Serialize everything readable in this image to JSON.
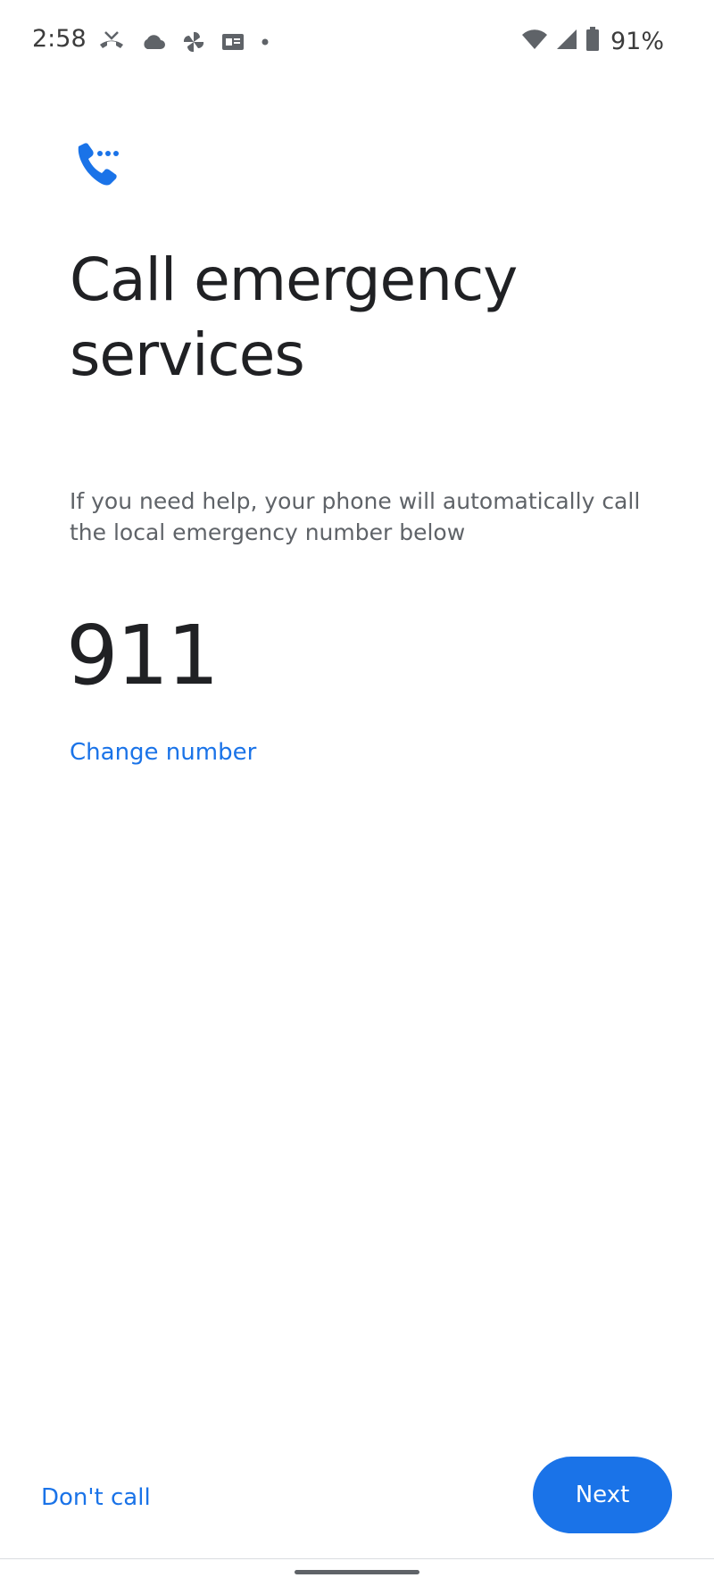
{
  "status_bar": {
    "time": "2:58",
    "battery_percent": "91%",
    "left_icons": [
      "missed-call-icon",
      "cloud-icon",
      "pinwheel-app-icon",
      "news-app-icon",
      "notification-dot-icon"
    ],
    "right_icons": [
      "wifi-icon",
      "cell-signal-icon",
      "battery-icon"
    ]
  },
  "header": {
    "icon": "phone-call-icon",
    "title": "Call emergency services"
  },
  "main": {
    "description": "If you need help, your phone will automatically call the local emergency number below",
    "emergency_number": "911",
    "change_number_label": "Change number"
  },
  "footer": {
    "dont_call_label": "Don't call",
    "next_label": "Next"
  },
  "colors": {
    "accent": "#1a73e8",
    "text_primary": "#202124",
    "text_secondary": "#5f6368",
    "background": "#ffffff"
  }
}
